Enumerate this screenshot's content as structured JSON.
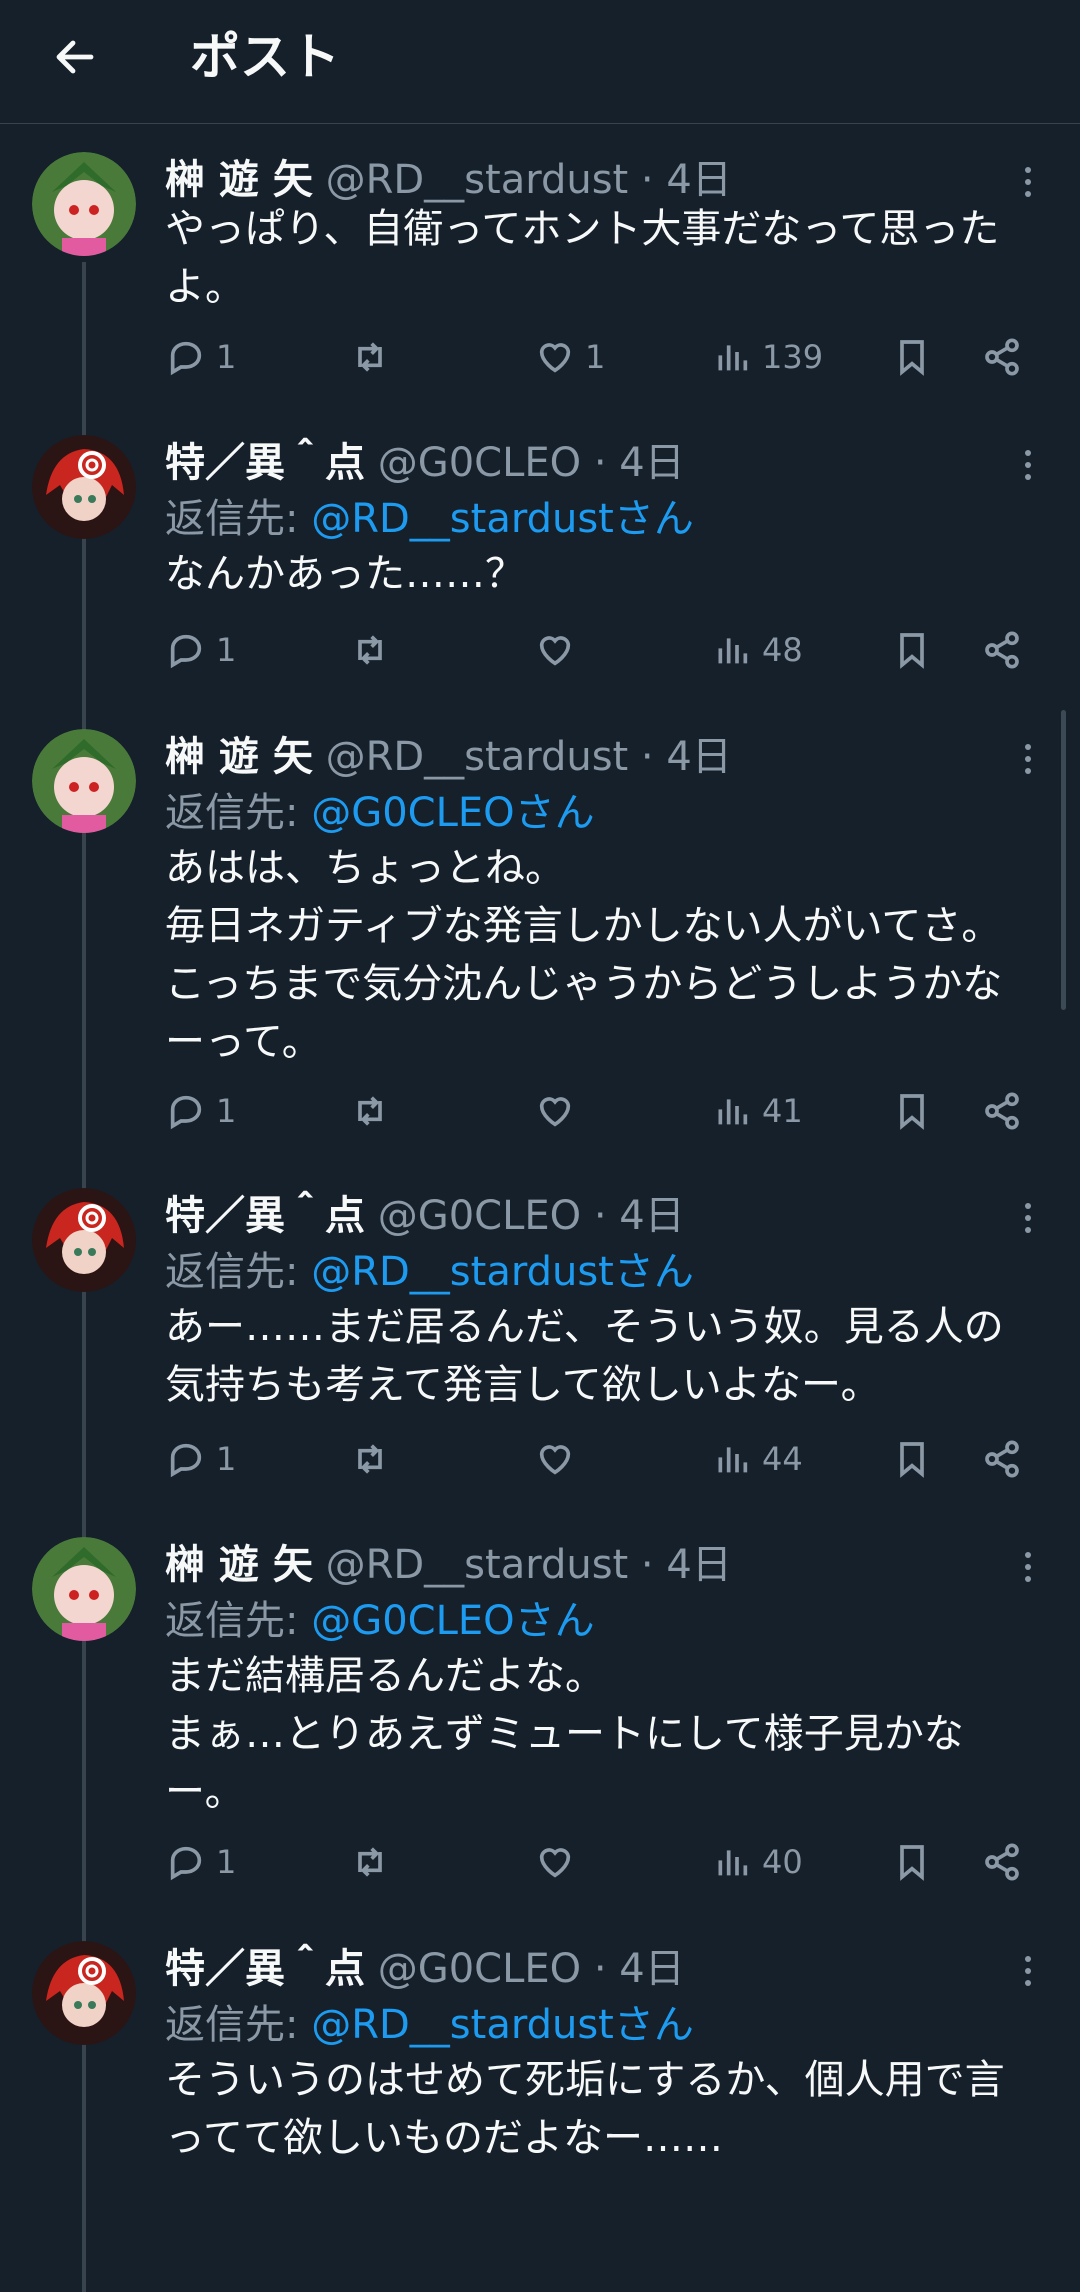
{
  "header": {
    "title": "ポスト",
    "back_icon": "arrow-left-icon"
  },
  "colors": {
    "background": "#15202b",
    "link": "#1d9bf0",
    "muted": "#8b98a5",
    "text": "#f7f9f9",
    "divider": "#38444d"
  },
  "posts": [
    {
      "name": "榊 遊 矢",
      "handle": "@RD__stardust",
      "time": "4日",
      "reply_prefix": "",
      "reply_handle": "",
      "text": "やっぱり、自衛ってホント大事だなって思った\nよ。",
      "replies": "1",
      "retweets": "",
      "likes": "1",
      "views": "139"
    },
    {
      "name": "特／異＾点",
      "handle": "@G0CLEO",
      "time": "4日",
      "reply_prefix": "返信先: ",
      "reply_handle": "@RD__stardustさん",
      "text": "なんかあった……？",
      "replies": "1",
      "retweets": "",
      "likes": "",
      "views": "48"
    },
    {
      "name": "榊 遊 矢",
      "handle": "@RD__stardust",
      "time": "4日",
      "reply_prefix": "返信先: ",
      "reply_handle": "@G0CLEOさん",
      "text": "あはは、ちょっとね。\n毎日ネガティブな発言しかしない人がいてさ。\nこっちまで気分沈んじゃうからどうしようかな\nーって。",
      "replies": "1",
      "retweets": "",
      "likes": "",
      "views": "41"
    },
    {
      "name": "特／異＾点",
      "handle": "@G0CLEO",
      "time": "4日",
      "reply_prefix": "返信先: ",
      "reply_handle": "@RD__stardustさん",
      "text": "あー……まだ居るんだ、そういう奴。見る人の\n気持ちも考えて発言して欲しいよなー。",
      "replies": "1",
      "retweets": "",
      "likes": "",
      "views": "44"
    },
    {
      "name": "榊 遊 矢",
      "handle": "@RD__stardust",
      "time": "4日",
      "reply_prefix": "返信先: ",
      "reply_handle": "@G0CLEOさん",
      "text": "まだ結構居るんだよな。\nまぁ…とりあえずミュートにして様子見かな\nー。",
      "replies": "1",
      "retweets": "",
      "likes": "",
      "views": "40"
    },
    {
      "name": "特／異＾点",
      "handle": "@G0CLEO",
      "time": "4日",
      "reply_prefix": "返信先: ",
      "reply_handle": "@RD__stardustさん",
      "text": "そういうのはせめて死垢にするか、個人用で言\nってて欲しいものだよなー……",
      "replies": "",
      "retweets": "",
      "likes": "",
      "views": ""
    }
  ]
}
